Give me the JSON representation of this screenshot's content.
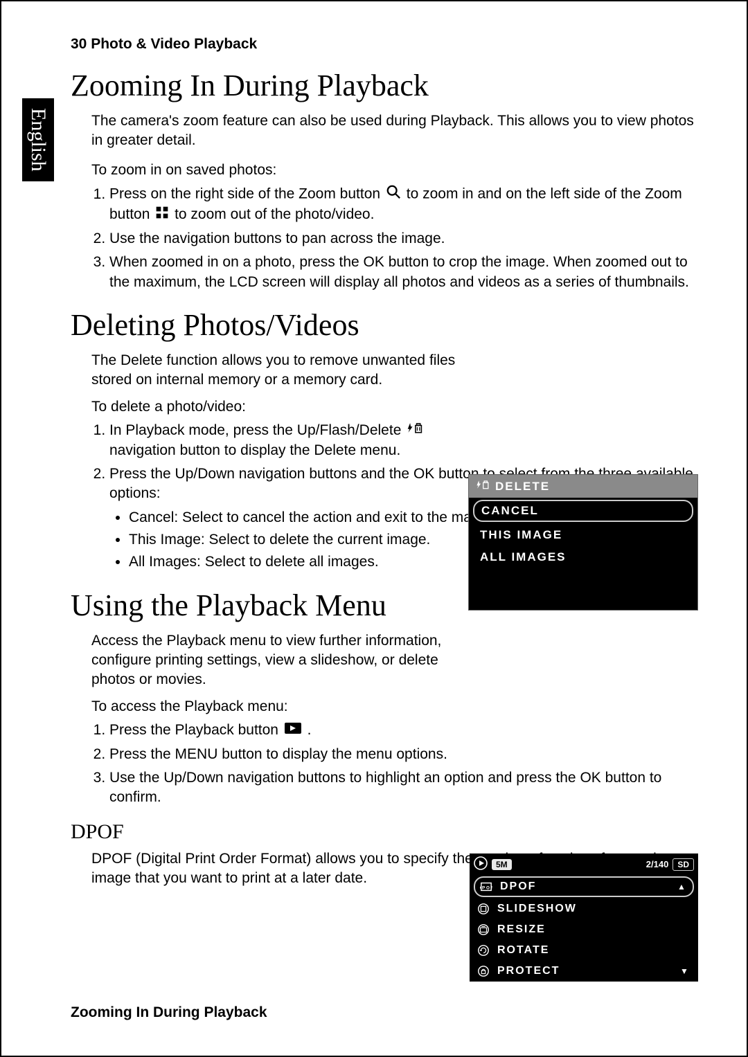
{
  "page": {
    "language_tab": "English",
    "header": "30  Photo & Video Playback",
    "footer": "Zooming In During Playback"
  },
  "section_zoom": {
    "title": "Zooming In During Playback",
    "intro": "The camera's zoom feature can also be used during Playback. This allows you to view photos in greater detail.",
    "lead": "To zoom in on saved photos:",
    "step1_a": "Press on the right side of the Zoom button ",
    "step1_b": " to zoom in and on the left side of the Zoom button ",
    "step1_c": " to zoom out of the photo/video.",
    "step2": "Use the navigation buttons to pan across the image.",
    "step3": "When zoomed in on a photo, press the OK button to crop the image. When zoomed out to the maximum, the LCD screen will display all photos and videos as a series of thumbnails."
  },
  "section_delete": {
    "title": "Deleting Photos/Videos",
    "intro": "The Delete function allows you to remove unwanted files stored on internal memory or a memory card.",
    "lead": "To delete a photo/video:",
    "step1_a": "In Playback mode, press the Up/Flash/Delete ",
    "step1_b": " navigation button to display the Delete menu.",
    "step2": "Press the Up/Down navigation buttons and the OK button to select from the three available options:",
    "bullet1": "Cancel: Select to cancel the action and exit to the main menu.",
    "bullet2": "This Image: Select to delete the current image.",
    "bullet3": "All Images: Select to delete all images."
  },
  "delete_menu": {
    "header": "DELETE",
    "opt1": "CANCEL",
    "opt2": "THIS IMAGE",
    "opt3": "ALL IMAGES"
  },
  "section_pbmenu": {
    "title": "Using the Playback Menu",
    "intro": "Access the Playback menu to view further information, configure printing settings, view a slideshow, or delete photos or movies.",
    "lead": "To access the Playback menu:",
    "step1": "Press the Playback button ",
    "step1_end": ".",
    "step2": "Press the MENU button to display the menu options.",
    "step3": "Use the Up/Down navigation buttons to highlight an option and press the OK button to confirm."
  },
  "pb_menu": {
    "res": "5M",
    "count": "2/140",
    "card": "SD",
    "item1": "DPOF",
    "item2": "SLIDESHOW",
    "item3": "RESIZE",
    "item4": "ROTATE",
    "item5": "PROTECT"
  },
  "section_dpof": {
    "title": "DPOF",
    "body": "DPOF (Digital Print Order Format) allows you to specify the number of copies of a certain image that you want to print at a later date."
  }
}
